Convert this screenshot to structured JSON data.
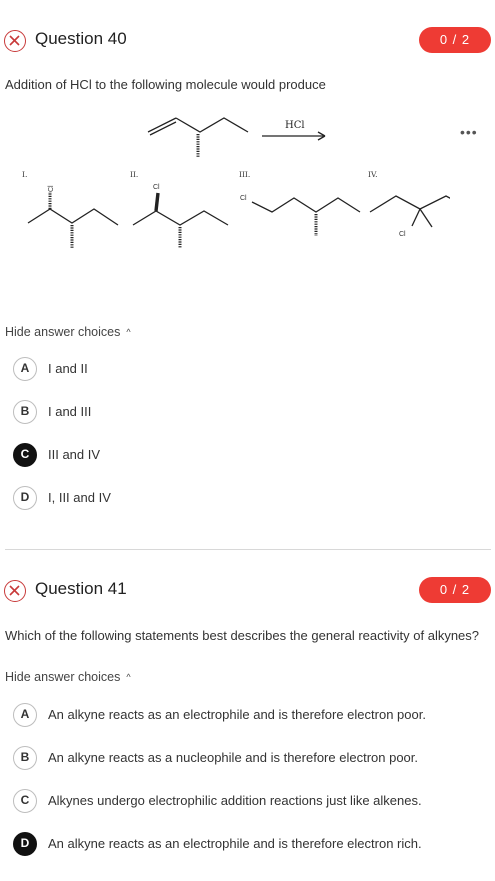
{
  "q40": {
    "title": "Question 40",
    "score": "0 / 2",
    "prompt": "Addition of HCl to the following molecule would produce",
    "reagent": "HCl",
    "numerals": [
      "I.",
      "II.",
      "III.",
      "IV."
    ],
    "atom_label": "Cl",
    "hide_label": "Hide answer choices",
    "choices": [
      {
        "letter": "A",
        "text": "I and II"
      },
      {
        "letter": "B",
        "text": "I and III"
      },
      {
        "letter": "C",
        "text": "III and IV"
      },
      {
        "letter": "D",
        "text": "I, III and IV"
      }
    ],
    "selected": "C"
  },
  "q41": {
    "title": "Question 41",
    "score": "0 / 2",
    "prompt": "Which of the following statements best describes the general reactivity of alkynes?",
    "hide_label": "Hide answer choices",
    "choices": [
      {
        "letter": "A",
        "text": "An alkyne reacts as an electrophile and is therefore electron poor."
      },
      {
        "letter": "B",
        "text": "An alkyne reacts as a nucleophile and is therefore electron poor."
      },
      {
        "letter": "C",
        "text": "Alkynes undergo electrophilic addition reactions just like alkenes."
      },
      {
        "letter": "D",
        "text": "An alkyne reacts as an electrophile and is therefore electron rich."
      }
    ],
    "selected": "D"
  },
  "more_label": "•••",
  "caret": "^",
  "colors": {
    "score_bg": "#ee3b34",
    "incorrect": "#c83a3a",
    "selected": "#111111"
  },
  "icons": {
    "incorrect": "x-circle-icon",
    "more": "more-dots-icon",
    "caret": "chevron-up-icon"
  }
}
